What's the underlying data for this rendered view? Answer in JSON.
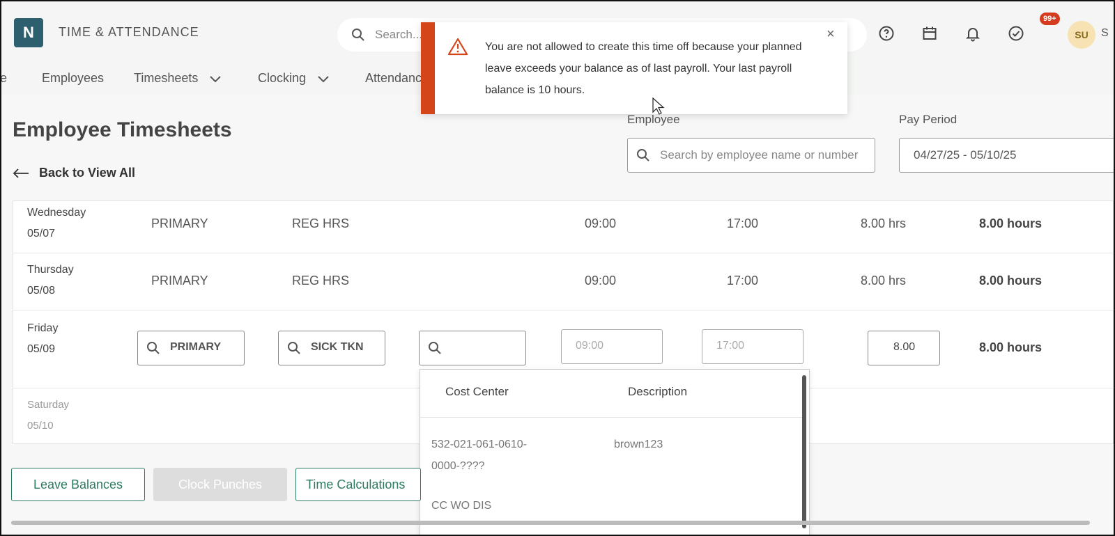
{
  "app": {
    "logo_letter": "N",
    "title": "TIME & ATTENDANCE"
  },
  "search": {
    "placeholder": "Search..."
  },
  "notifications": {
    "badge": "99+"
  },
  "user": {
    "initials": "SU",
    "name_partial": "S"
  },
  "nav": {
    "items": [
      {
        "label": "e"
      },
      {
        "label": "Employees"
      },
      {
        "label": "Timesheets"
      },
      {
        "label": "Clocking"
      },
      {
        "label": "Attendanc"
      }
    ]
  },
  "toast": {
    "message": "You are not allowed to create this time off because your planned leave exceeds your balance as of last payroll. Your last payroll balance is 10 hours.",
    "accent": "#d4451a"
  },
  "page": {
    "title": "Employee Timesheets",
    "back_label": "Back to View All"
  },
  "filters": {
    "employee_label": "Employee",
    "employee_placeholder": "Search by employee name or number",
    "pay_period_label": "Pay Period",
    "pay_period_value": "04/27/25 - 05/10/25"
  },
  "rows": [
    {
      "day": "Wednesday",
      "date": "05/07",
      "job": "PRIMARY",
      "pay_code": "REG HRS",
      "start": "09:00",
      "end": "17:00",
      "hrs": "8.00 hrs",
      "total": "8.00 hours"
    },
    {
      "day": "Thursday",
      "date": "05/08",
      "job": "PRIMARY",
      "pay_code": "REG HRS",
      "start": "09:00",
      "end": "17:00",
      "hrs": "8.00 hrs",
      "total": "8.00 hours"
    },
    {
      "day": "Friday",
      "date": "05/09",
      "job": "PRIMARY",
      "pay_code": "SICK TKN",
      "cost_center": "",
      "start": "09:00",
      "end": "17:00",
      "hrs": "8.00",
      "total": "8.00 hours"
    },
    {
      "day": "Saturday",
      "date": "05/10"
    }
  ],
  "cost_center_dropdown": {
    "col_cost_center": "Cost Center",
    "col_description": "Description",
    "options": [
      {
        "code_line1": "532-021-061-0610-",
        "code_line2": "0000-????",
        "description": "brown123"
      },
      {
        "code_line1": "CC WO DIS",
        "description": ""
      }
    ]
  },
  "buttons": {
    "leave_balances": "Leave Balances",
    "clock_punches": "Clock Punches",
    "time_calculations": "Time Calculations"
  }
}
